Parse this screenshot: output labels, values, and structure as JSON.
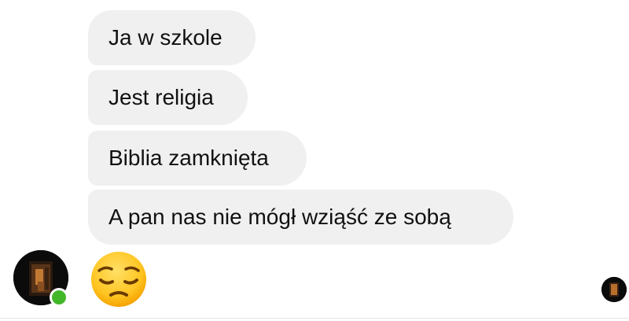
{
  "chat": {
    "messages": [
      {
        "text": "Ja w szkole"
      },
      {
        "text": "Jest religia"
      },
      {
        "text": "Biblia zamknięta"
      },
      {
        "text": "A pan nas nie mógł wziąść ze sobą"
      }
    ],
    "reaction_emoji_icon": "pensive-face-emoji",
    "sender_avatar_icon": "profile-photo-dark",
    "sender_status": "online",
    "colors": {
      "bubble": "#f0f0f0",
      "text": "#111111",
      "online": "#42b72a"
    }
  }
}
